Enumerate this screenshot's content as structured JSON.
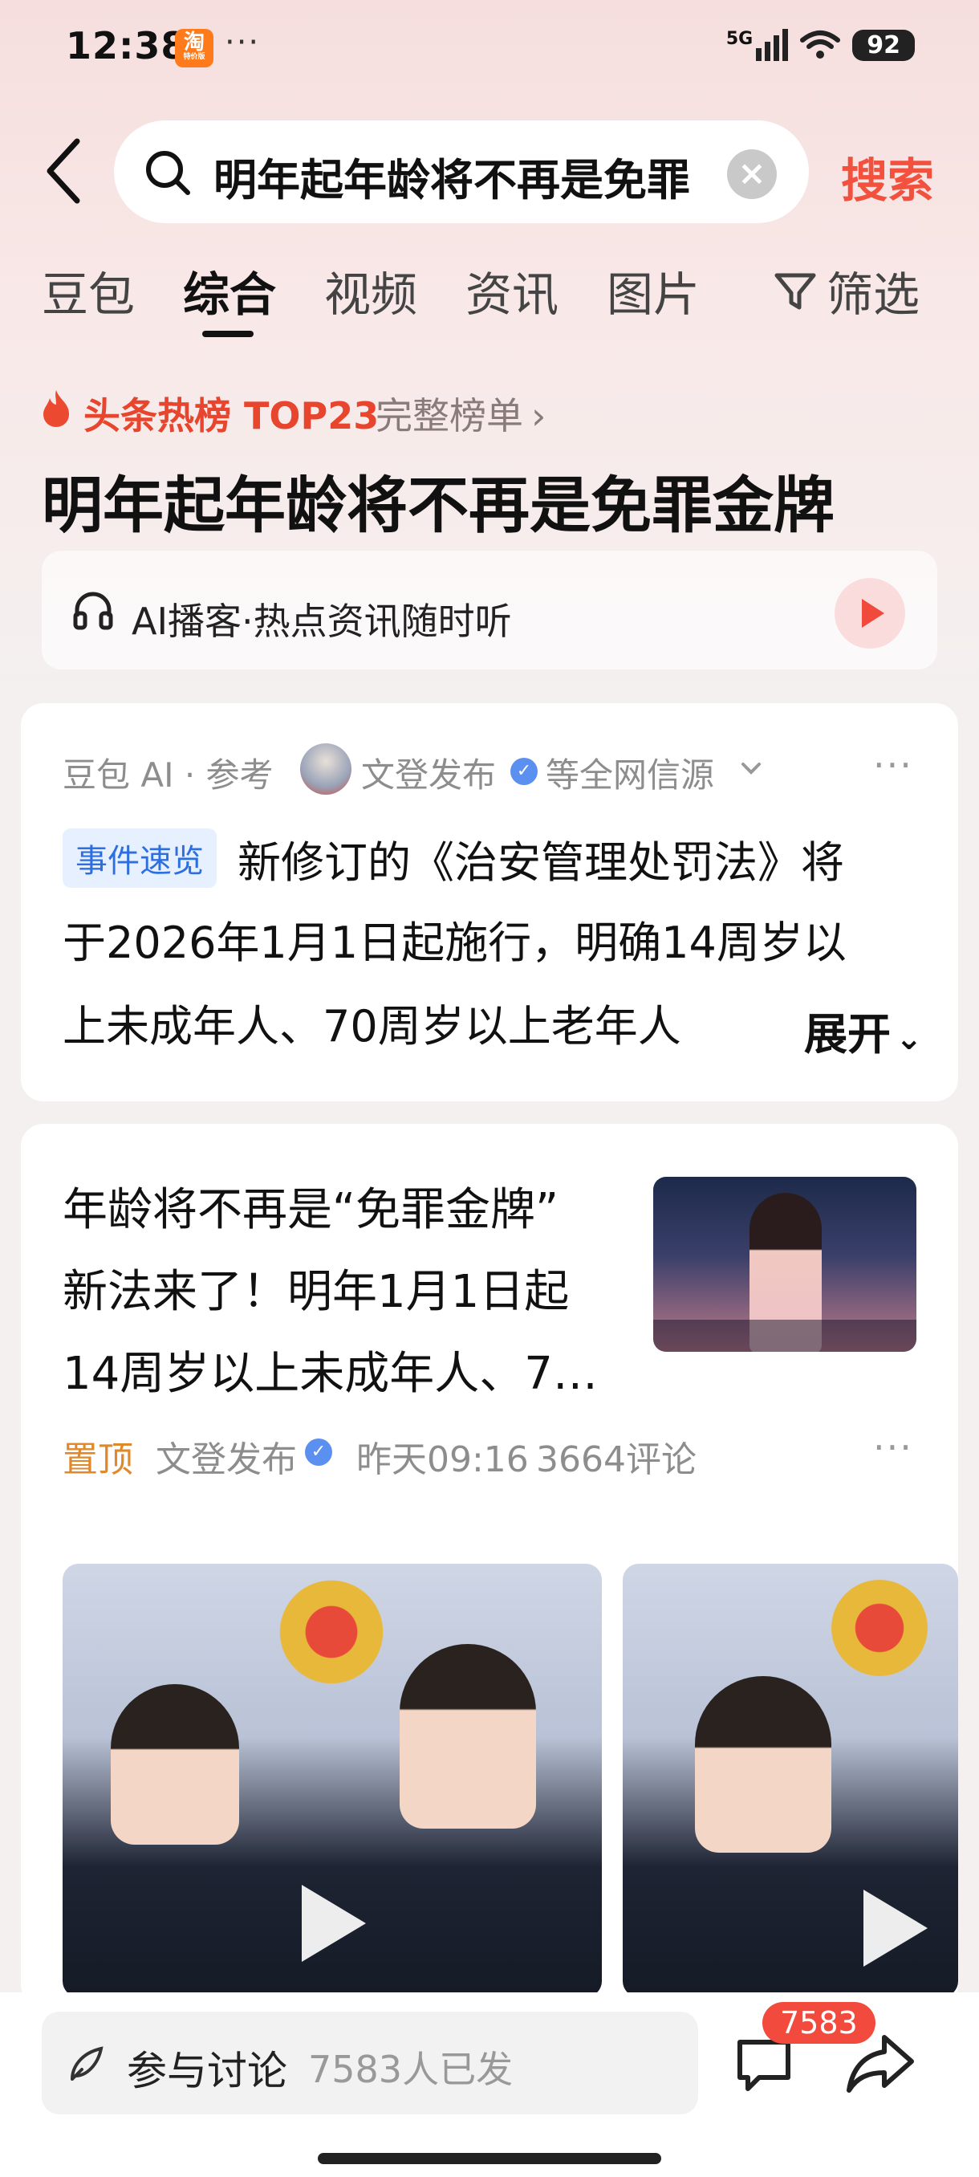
{
  "status_bar": {
    "time": "12:38",
    "app_badge_main": "淘",
    "app_badge_sub": "特价版",
    "more_dots": "···",
    "network": "5G",
    "battery": "92"
  },
  "search": {
    "query": "明年起年龄将不再是免罪",
    "button_label": "搜索"
  },
  "tabs": [
    {
      "label": "豆包",
      "active": false
    },
    {
      "label": "综合",
      "active": true
    },
    {
      "label": "视频",
      "active": false
    },
    {
      "label": "资讯",
      "active": false
    },
    {
      "label": "图片",
      "active": false
    }
  ],
  "filter_label": "筛选",
  "hot_list": {
    "label": "头条热榜 TOP23",
    "full_list_label": "完整榜单",
    "headline": "明年起年龄将不再是免罪金牌"
  },
  "podcast": {
    "label": "AI播客·热点资讯随时听"
  },
  "ai_card": {
    "source_prefix": "豆包 AI · 参考",
    "source_name": "文登发布",
    "source_suffix": "等全网信源",
    "tag": "事件速览",
    "lines": [
      "新修订的《治安管理处罚法》将",
      "于2026年1月1日起施行，明确14周岁以",
      "上未成年人、70周岁以上老年人"
    ],
    "expand_label": "展开"
  },
  "news_card": {
    "title_lines": [
      "年龄将不再是“免罪金牌”",
      "新法来了！明年1月1日起",
      "14周岁以上未成年人、7…"
    ],
    "pin_label": "置顶",
    "author": "文登发布",
    "time": "昨天09:16",
    "comments": "3664评论"
  },
  "bottom_bar": {
    "discuss_label": "参与讨论",
    "discuss_count": "7583人已发",
    "comment_badge": "7583"
  },
  "colors": {
    "accent_red": "#f2513e",
    "hot_red": "#e8452f",
    "tag_blue": "#2e6fe0",
    "pin_orange": "#e0892a",
    "verified_blue": "#5b8ff0"
  }
}
